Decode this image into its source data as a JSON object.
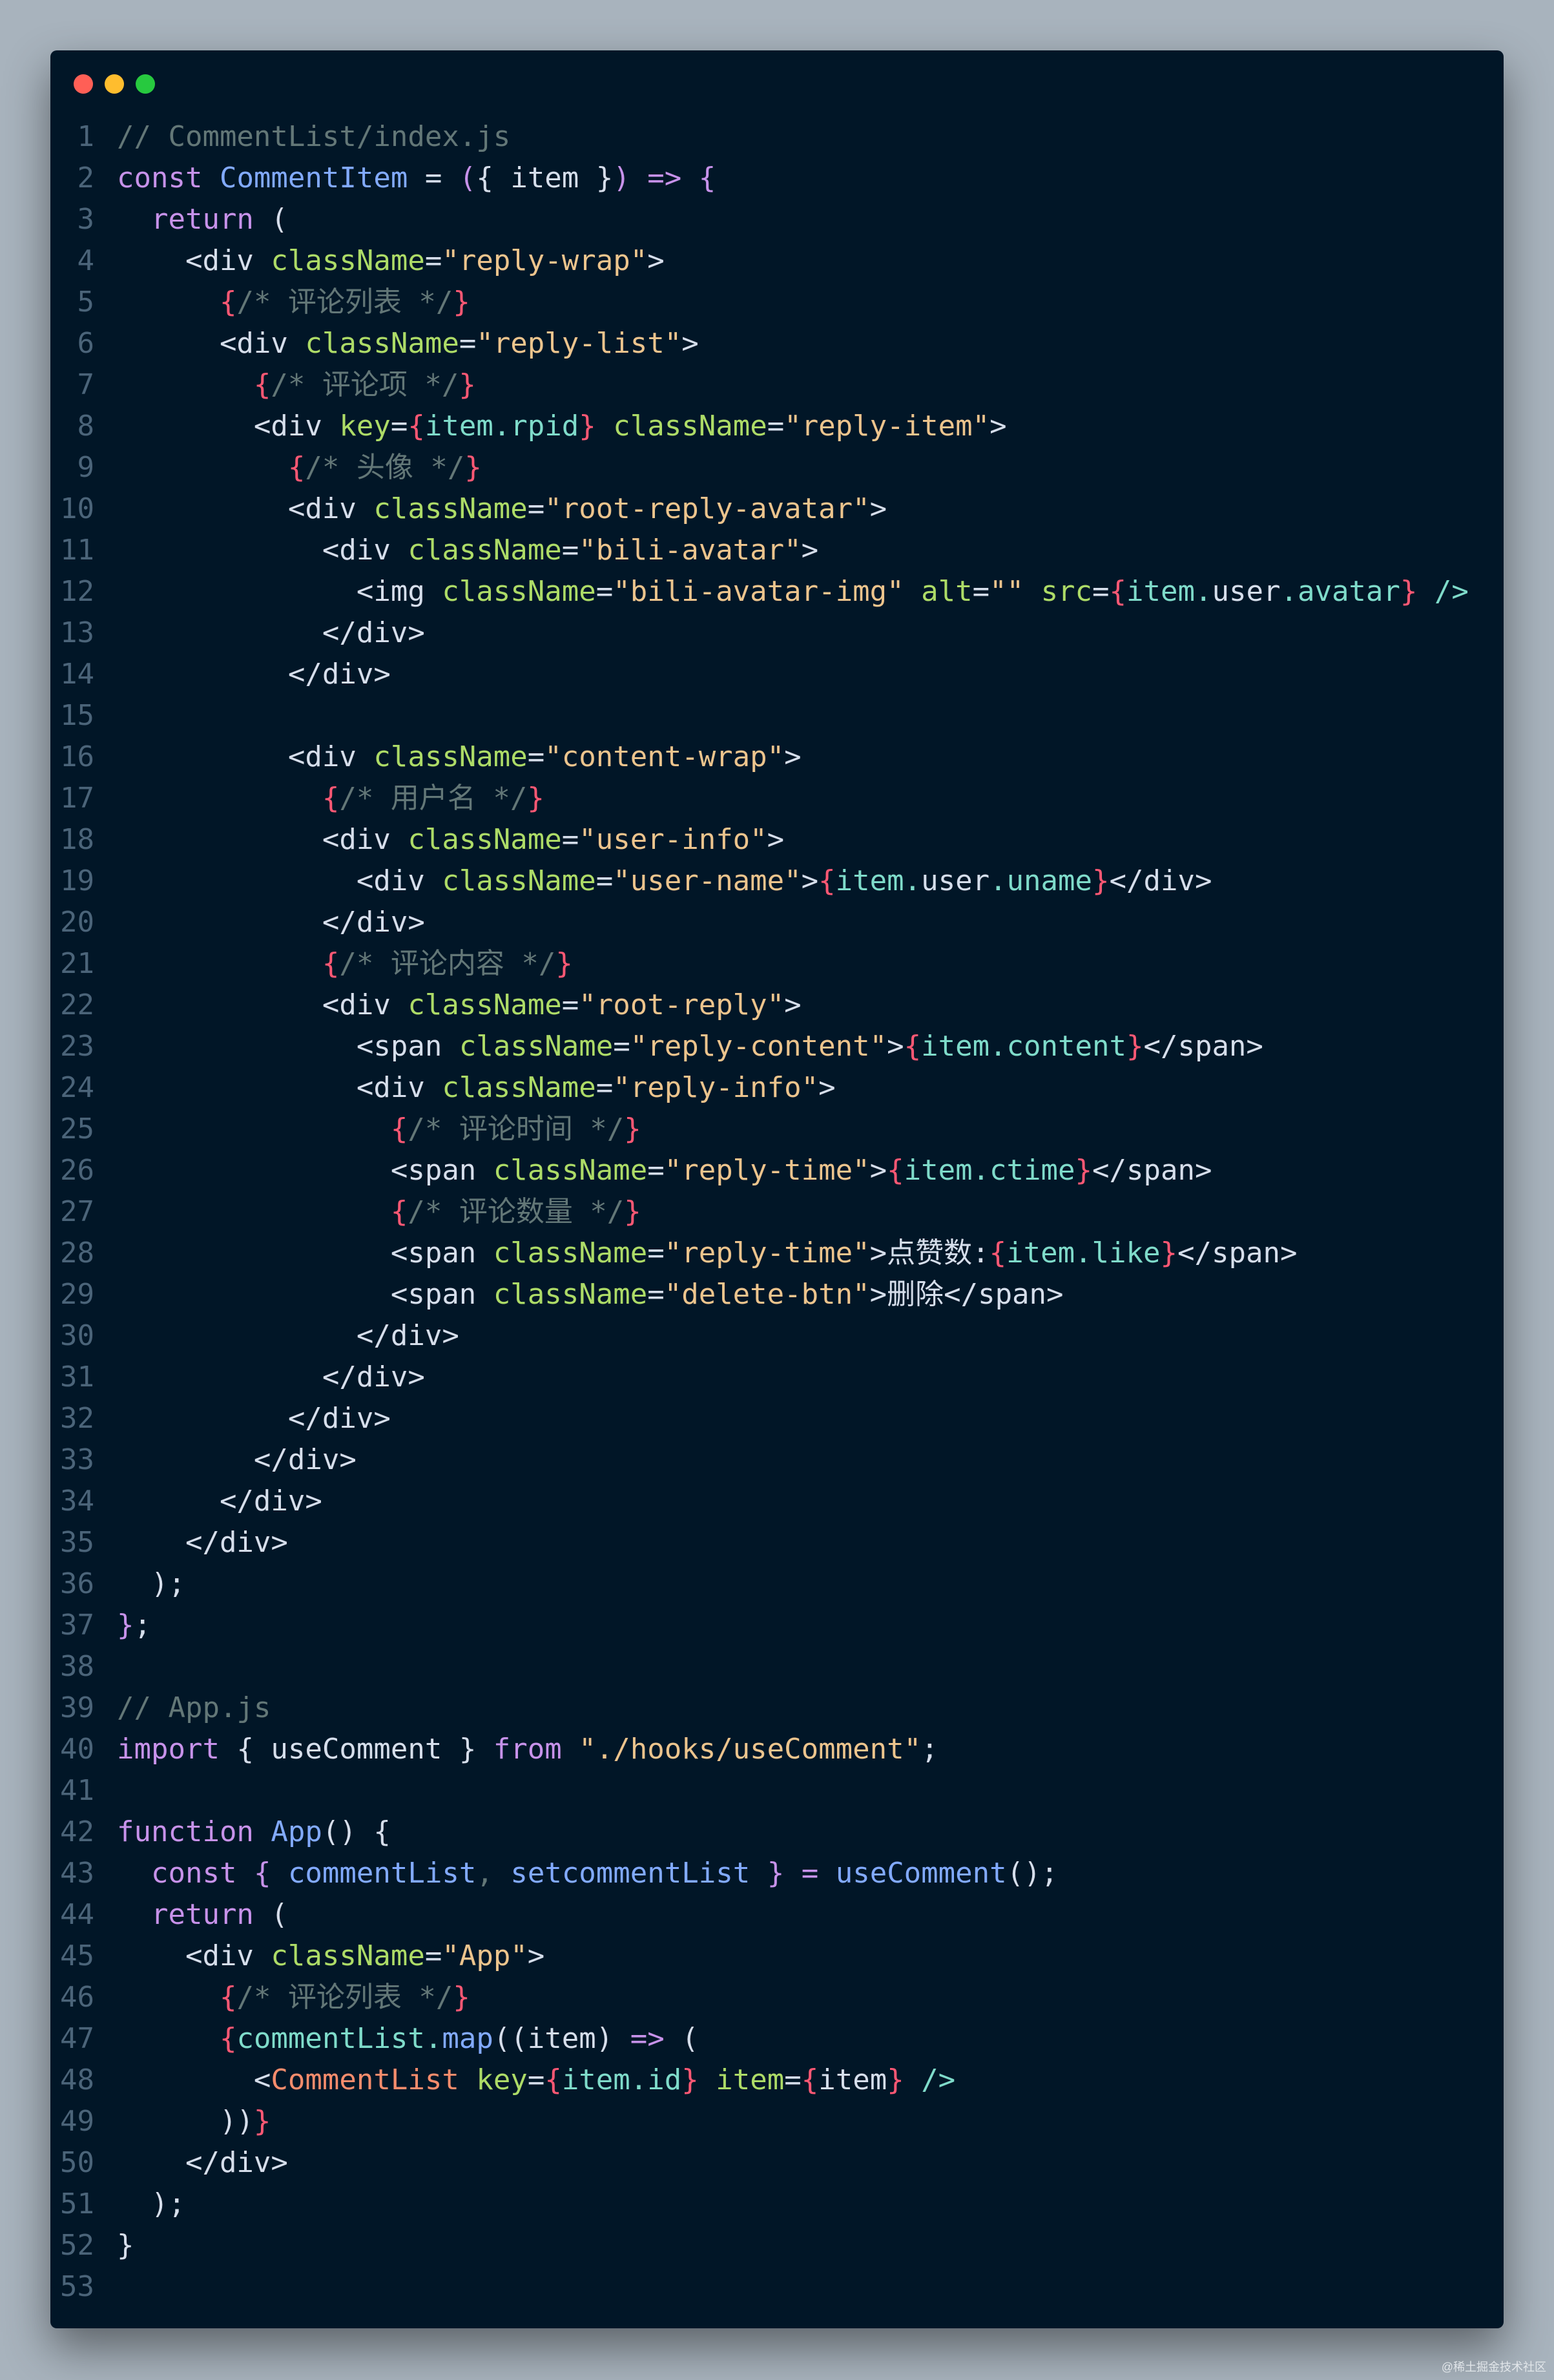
{
  "window": {
    "buttons": [
      "close",
      "minimize",
      "zoom"
    ]
  },
  "colors": {
    "background": "#011627",
    "page": "#a8b3bd",
    "comment": "#637777",
    "keyword": "#c792ea",
    "function": "#82aaff",
    "attr": "#addb67",
    "string": "#ecc48d",
    "brace": "#ff5874",
    "variable": "#7fdbca",
    "text": "#d6deeb",
    "tag": "#f78c6c"
  },
  "watermark": "@稀土掘金技术社区",
  "code": {
    "lines": [
      [
        [
          "c",
          "// CommentList/index.js"
        ]
      ],
      [
        [
          "k",
          "const "
        ],
        [
          "f",
          "CommentItem"
        ],
        [
          "t",
          " = "
        ],
        [
          "k",
          "("
        ],
        [
          "t",
          "{ "
        ],
        [
          "t",
          "item"
        ],
        [
          "t",
          " }"
        ],
        [
          "k",
          ")"
        ],
        [
          "t",
          " "
        ],
        [
          "k",
          "=>"
        ],
        [
          "t",
          " "
        ],
        [
          "k",
          "{"
        ]
      ],
      [
        [
          "t",
          "  "
        ],
        [
          "k",
          "return"
        ],
        [
          "t",
          " ("
        ]
      ],
      [
        [
          "t",
          "    <div "
        ],
        [
          "a",
          "className"
        ],
        [
          "t",
          "="
        ],
        [
          "s",
          "\"reply-wrap\""
        ],
        [
          "t",
          ">"
        ]
      ],
      [
        [
          "t",
          "      "
        ],
        [
          "b",
          "{"
        ],
        [
          "c",
          "/* 评论列表 */"
        ],
        [
          "b",
          "}"
        ]
      ],
      [
        [
          "t",
          "      <div "
        ],
        [
          "a",
          "className"
        ],
        [
          "t",
          "="
        ],
        [
          "s",
          "\"reply-list\""
        ],
        [
          "t",
          ">"
        ]
      ],
      [
        [
          "t",
          "        "
        ],
        [
          "b",
          "{"
        ],
        [
          "c",
          "/* 评论项 */"
        ],
        [
          "b",
          "}"
        ]
      ],
      [
        [
          "t",
          "        <div "
        ],
        [
          "a",
          "key"
        ],
        [
          "t",
          "="
        ],
        [
          "b",
          "{"
        ],
        [
          "v",
          "item.rpid"
        ],
        [
          "b",
          "}"
        ],
        [
          "t",
          " "
        ],
        [
          "a",
          "className"
        ],
        [
          "t",
          "="
        ],
        [
          "s",
          "\"reply-item\""
        ],
        [
          "t",
          ">"
        ]
      ],
      [
        [
          "t",
          "          "
        ],
        [
          "b",
          "{"
        ],
        [
          "c",
          "/* 头像 */"
        ],
        [
          "b",
          "}"
        ]
      ],
      [
        [
          "t",
          "          <div "
        ],
        [
          "a",
          "className"
        ],
        [
          "t",
          "="
        ],
        [
          "s",
          "\"root-reply-avatar\""
        ],
        [
          "t",
          ">"
        ]
      ],
      [
        [
          "t",
          "            <div "
        ],
        [
          "a",
          "className"
        ],
        [
          "t",
          "="
        ],
        [
          "s",
          "\"bili-avatar\""
        ],
        [
          "t",
          ">"
        ]
      ],
      [
        [
          "t",
          "              <img "
        ],
        [
          "a",
          "className"
        ],
        [
          "t",
          "="
        ],
        [
          "s",
          "\"bili-avatar-img\""
        ],
        [
          "t",
          " "
        ],
        [
          "a",
          "alt"
        ],
        [
          "t",
          "="
        ],
        [
          "s",
          "\"\""
        ],
        [
          "t",
          " "
        ],
        [
          "a",
          "src"
        ],
        [
          "t",
          "="
        ],
        [
          "b",
          "{"
        ],
        [
          "v",
          "item."
        ],
        [
          "t",
          "user"
        ],
        [
          "v",
          ".avatar"
        ],
        [
          "b",
          "}"
        ],
        [
          "t",
          " "
        ],
        [
          "v",
          "/>"
        ]
      ],
      [
        [
          "t",
          "            </div>"
        ]
      ],
      [
        [
          "t",
          "          </div>"
        ]
      ],
      [
        [
          "t",
          ""
        ]
      ],
      [
        [
          "t",
          "          <div "
        ],
        [
          "a",
          "className"
        ],
        [
          "t",
          "="
        ],
        [
          "s",
          "\"content-wrap\""
        ],
        [
          "t",
          ">"
        ]
      ],
      [
        [
          "t",
          "            "
        ],
        [
          "b",
          "{"
        ],
        [
          "c",
          "/* 用户名 */"
        ],
        [
          "b",
          "}"
        ]
      ],
      [
        [
          "t",
          "            <div "
        ],
        [
          "a",
          "className"
        ],
        [
          "t",
          "="
        ],
        [
          "s",
          "\"user-info\""
        ],
        [
          "t",
          ">"
        ]
      ],
      [
        [
          "t",
          "              <div "
        ],
        [
          "a",
          "className"
        ],
        [
          "t",
          "="
        ],
        [
          "s",
          "\"user-name\""
        ],
        [
          "t",
          ">"
        ],
        [
          "b",
          "{"
        ],
        [
          "v",
          "item."
        ],
        [
          "t",
          "user"
        ],
        [
          "v",
          ".uname"
        ],
        [
          "b",
          "}"
        ],
        [
          "t",
          "</div>"
        ]
      ],
      [
        [
          "t",
          "            </div>"
        ]
      ],
      [
        [
          "t",
          "            "
        ],
        [
          "b",
          "{"
        ],
        [
          "c",
          "/* 评论内容 */"
        ],
        [
          "b",
          "}"
        ]
      ],
      [
        [
          "t",
          "            <div "
        ],
        [
          "a",
          "className"
        ],
        [
          "t",
          "="
        ],
        [
          "s",
          "\"root-reply\""
        ],
        [
          "t",
          ">"
        ]
      ],
      [
        [
          "t",
          "              <span "
        ],
        [
          "a",
          "className"
        ],
        [
          "t",
          "="
        ],
        [
          "s",
          "\"reply-content\""
        ],
        [
          "t",
          ">"
        ],
        [
          "b",
          "{"
        ],
        [
          "v",
          "item.content"
        ],
        [
          "b",
          "}"
        ],
        [
          "t",
          "</span>"
        ]
      ],
      [
        [
          "t",
          "              <div "
        ],
        [
          "a",
          "className"
        ],
        [
          "t",
          "="
        ],
        [
          "s",
          "\"reply-info\""
        ],
        [
          "t",
          ">"
        ]
      ],
      [
        [
          "t",
          "                "
        ],
        [
          "b",
          "{"
        ],
        [
          "c",
          "/* 评论时间 */"
        ],
        [
          "b",
          "}"
        ]
      ],
      [
        [
          "t",
          "                <span "
        ],
        [
          "a",
          "className"
        ],
        [
          "t",
          "="
        ],
        [
          "s",
          "\"reply-time\""
        ],
        [
          "t",
          ">"
        ],
        [
          "b",
          "{"
        ],
        [
          "v",
          "item.ctime"
        ],
        [
          "b",
          "}"
        ],
        [
          "t",
          "</span>"
        ]
      ],
      [
        [
          "t",
          "                "
        ],
        [
          "b",
          "{"
        ],
        [
          "c",
          "/* 评论数量 */"
        ],
        [
          "b",
          "}"
        ]
      ],
      [
        [
          "t",
          "                <span "
        ],
        [
          "a",
          "className"
        ],
        [
          "t",
          "="
        ],
        [
          "s",
          "\"reply-time\""
        ],
        [
          "t",
          ">点赞数:"
        ],
        [
          "b",
          "{"
        ],
        [
          "v",
          "item.like"
        ],
        [
          "b",
          "}"
        ],
        [
          "t",
          "</span>"
        ]
      ],
      [
        [
          "t",
          "                <span "
        ],
        [
          "a",
          "className"
        ],
        [
          "t",
          "="
        ],
        [
          "s",
          "\"delete-btn\""
        ],
        [
          "t",
          ">删除</span>"
        ]
      ],
      [
        [
          "t",
          "              </div>"
        ]
      ],
      [
        [
          "t",
          "            </div>"
        ]
      ],
      [
        [
          "t",
          "          </div>"
        ]
      ],
      [
        [
          "t",
          "        </div>"
        ]
      ],
      [
        [
          "t",
          "      </div>"
        ]
      ],
      [
        [
          "t",
          "    </div>"
        ]
      ],
      [
        [
          "t",
          "  );"
        ]
      ],
      [
        [
          "k",
          "}"
        ],
        [
          "t",
          ";"
        ]
      ],
      [
        [
          "t",
          ""
        ]
      ],
      [
        [
          "c",
          "// App.js"
        ]
      ],
      [
        [
          "k",
          "import"
        ],
        [
          "t",
          " { useComment } "
        ],
        [
          "k",
          "from"
        ],
        [
          "t",
          " "
        ],
        [
          "s",
          "\"./hooks/useComment\""
        ],
        [
          "t",
          ";"
        ]
      ],
      [
        [
          "t",
          ""
        ]
      ],
      [
        [
          "k",
          "function"
        ],
        [
          "t",
          " "
        ],
        [
          "f",
          "App"
        ],
        [
          "t",
          "() {"
        ]
      ],
      [
        [
          "t",
          "  "
        ],
        [
          "k",
          "const"
        ],
        [
          "t",
          " "
        ],
        [
          "k",
          "{"
        ],
        [
          "t",
          " "
        ],
        [
          "f",
          "commentList"
        ],
        [
          "c",
          ","
        ],
        [
          "t",
          " "
        ],
        [
          "f",
          "setcommentList"
        ],
        [
          "t",
          " "
        ],
        [
          "k",
          "}"
        ],
        [
          "t",
          " "
        ],
        [
          "k",
          "="
        ],
        [
          "t",
          " "
        ],
        [
          "f",
          "useComment"
        ],
        [
          "t",
          "();"
        ]
      ],
      [
        [
          "t",
          "  "
        ],
        [
          "k",
          "return"
        ],
        [
          "t",
          " ("
        ]
      ],
      [
        [
          "t",
          "    <div "
        ],
        [
          "a",
          "className"
        ],
        [
          "t",
          "="
        ],
        [
          "s",
          "\"App\""
        ],
        [
          "t",
          ">"
        ]
      ],
      [
        [
          "t",
          "      "
        ],
        [
          "b",
          "{"
        ],
        [
          "c",
          "/* 评论列表 */"
        ],
        [
          "b",
          "}"
        ]
      ],
      [
        [
          "t",
          "      "
        ],
        [
          "b",
          "{"
        ],
        [
          "v",
          "commentList."
        ],
        [
          "f",
          "map"
        ],
        [
          "t",
          "((item) "
        ],
        [
          "k",
          "=>"
        ],
        [
          "t",
          " ("
        ]
      ],
      [
        [
          "t",
          "        <"
        ],
        [
          "g",
          "CommentList"
        ],
        [
          "t",
          " "
        ],
        [
          "a",
          "key"
        ],
        [
          "t",
          "="
        ],
        [
          "b",
          "{"
        ],
        [
          "v",
          "item.id"
        ],
        [
          "b",
          "}"
        ],
        [
          "t",
          " "
        ],
        [
          "a",
          "item"
        ],
        [
          "t",
          "="
        ],
        [
          "b",
          "{"
        ],
        [
          "t",
          "item"
        ],
        [
          "b",
          "}"
        ],
        [
          "t",
          " "
        ],
        [
          "v",
          "/>"
        ]
      ],
      [
        [
          "t",
          "      ))"
        ],
        [
          "b",
          "}"
        ]
      ],
      [
        [
          "t",
          "    </div>"
        ]
      ],
      [
        [
          "t",
          "  );"
        ]
      ],
      [
        [
          "t",
          "}"
        ]
      ],
      [
        [
          "t",
          ""
        ]
      ]
    ]
  }
}
